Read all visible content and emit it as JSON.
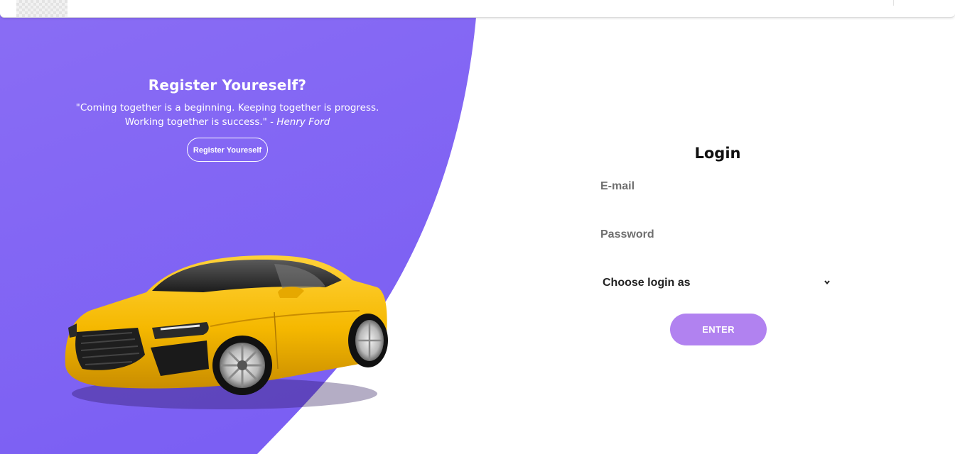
{
  "colors": {
    "panel_top": "#8a6df4",
    "panel_bottom": "#7b5ff3",
    "enter_button": "#b182f0",
    "car_body": "#f5b800"
  },
  "promo": {
    "title": "Register Youreself?",
    "quote": "\"Coming together is a beginning. Keeping together is progress. Working together is success.\" -",
    "author": "Henry Ford",
    "button_label": "Register Youreself"
  },
  "login": {
    "title": "Login",
    "email_placeholder": "E-mail",
    "password_placeholder": "Password",
    "role_select_label": "Choose login as",
    "enter_label": "ENTER"
  },
  "icons": {
    "select_chevron": "chevron-down-icon",
    "topbar_logo": "logo-placeholder"
  }
}
